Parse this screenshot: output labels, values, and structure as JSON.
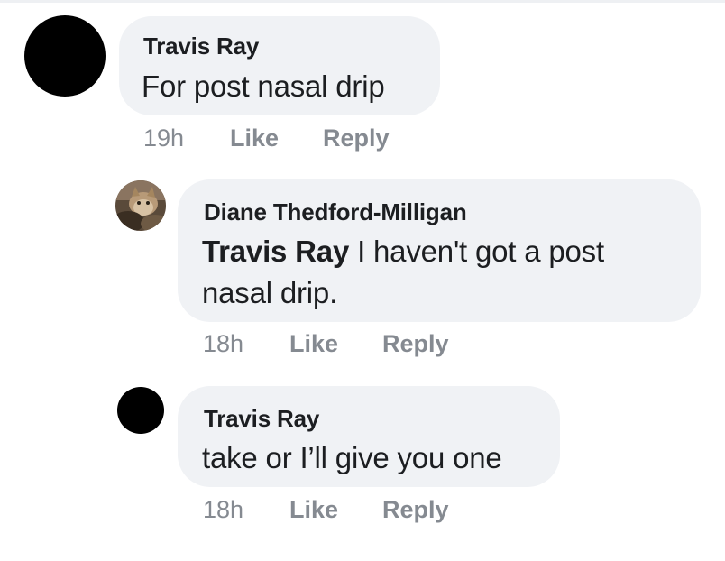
{
  "comments": [
    {
      "author": "Travis Ray",
      "text": "For post nasal drip",
      "time": "19h",
      "like_label": "Like",
      "reply_label": "Reply",
      "avatar": "black-circle"
    },
    {
      "author": "Diane Thedford-Milligan",
      "mention": "Travis Ray",
      "text_line1": " I haven't got a post",
      "text_line2": "nasal drip.",
      "time": "18h",
      "like_label": "Like",
      "reply_label": "Reply",
      "avatar": "cat-photo"
    },
    {
      "author": "Travis Ray",
      "text": "take or I’ll give you one",
      "time": "18h",
      "like_label": "Like",
      "reply_label": "Reply",
      "avatar": "black-circle"
    }
  ],
  "colors": {
    "bubble": "#f0f2f5",
    "text": "#1c1e21",
    "meta": "#858a91"
  }
}
